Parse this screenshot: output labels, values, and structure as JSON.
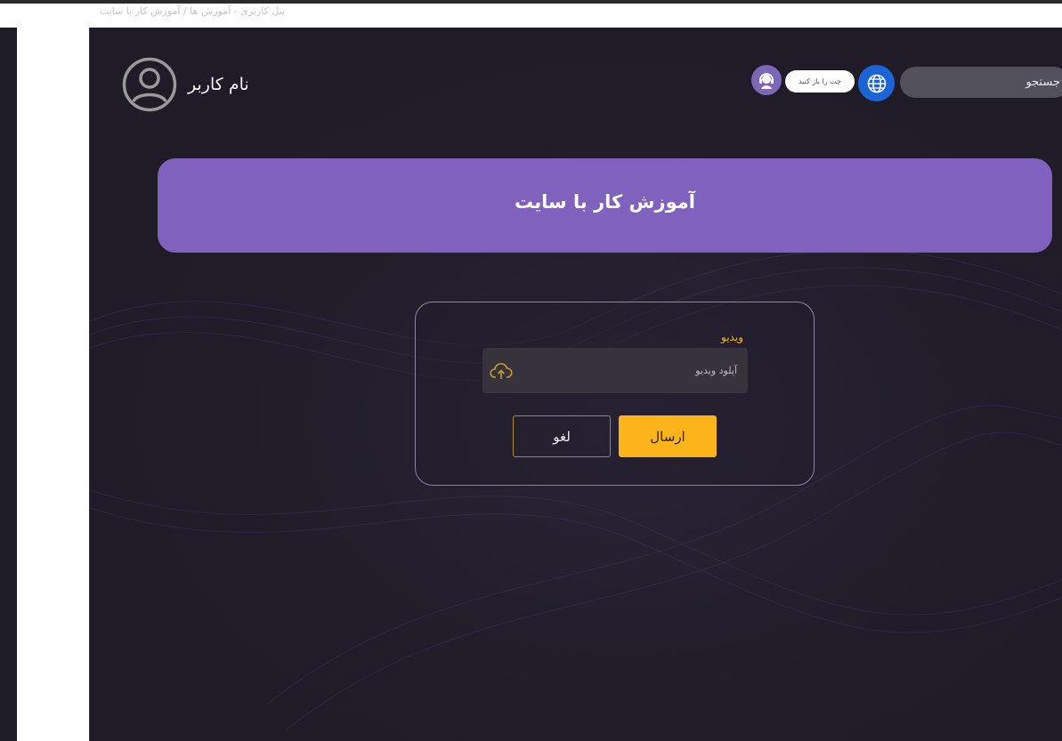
{
  "breadcrumb": "پنل کاربری - آموزش ها / آموزش کار با سایت",
  "header": {
    "username": "نام کاربر",
    "chat_label": "چت را باز کنید",
    "search_placeholder": "جستجو"
  },
  "banner": {
    "title": "آموزش کار با سایت"
  },
  "form": {
    "field_label": "ویدیو",
    "upload_placeholder": "آپلود ویدیو",
    "submit_label": "ارسال",
    "cancel_label": "لغو"
  },
  "colors": {
    "background": "#1f1c27",
    "accent_purple": "#7f62bd",
    "accent_yellow": "#fbb51a",
    "globe_blue": "#1a64d6"
  },
  "icons": [
    "user-avatar-icon",
    "support-agent-icon",
    "globe-icon",
    "cloud-upload-icon"
  ]
}
